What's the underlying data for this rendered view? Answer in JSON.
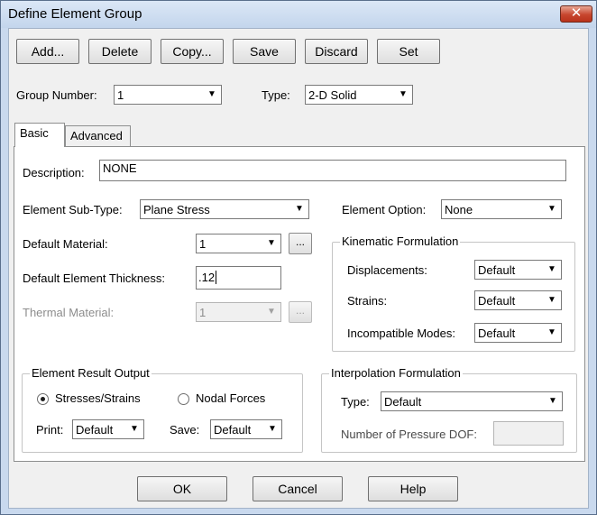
{
  "window": {
    "title": "Define Element Group",
    "close_glyph": "✕"
  },
  "toolbar": {
    "add": "Add...",
    "delete": "Delete",
    "copy": "Copy...",
    "save": "Save",
    "discard": "Discard",
    "set": "Set"
  },
  "header": {
    "group_number_label": "Group Number:",
    "group_number_value": "1",
    "type_label": "Type:",
    "type_value": "2-D Solid"
  },
  "tabs": {
    "basic": "Basic",
    "advanced": "Advanced"
  },
  "basic": {
    "description_label": "Description:",
    "description_value": "NONE",
    "subtype_label": "Element Sub-Type:",
    "subtype_value": "Plane Stress",
    "option_label": "Element Option:",
    "option_value": "None",
    "material_label": "Default Material:",
    "material_value": "1",
    "thickness_label": "Default Element Thickness:",
    "thickness_value": ".12",
    "thermal_label": "Thermal Material:",
    "thermal_value": "1",
    "browse_label": "...",
    "kinematic": {
      "title": "Kinematic Formulation",
      "displacements_label": "Displacements:",
      "displacements_value": "Default",
      "strains_label": "Strains:",
      "strains_value": "Default",
      "incompatible_label": "Incompatible Modes:",
      "incompatible_value": "Default"
    },
    "result_output": {
      "title": "Element Result Output",
      "stresses_strains": "Stresses/Strains",
      "nodal_forces": "Nodal Forces",
      "selected": "stresses_strains",
      "print_label": "Print:",
      "print_value": "Default",
      "save_label": "Save:",
      "save_value": "Default"
    },
    "interpolation": {
      "title": "Interpolation Formulation",
      "type_label": "Type:",
      "type_value": "Default",
      "pressure_dof_label": "Number of Pressure DOF:",
      "pressure_dof_value": ""
    }
  },
  "footer": {
    "ok": "OK",
    "cancel": "Cancel",
    "help": "Help"
  },
  "icons": {
    "dropdown": "chevron-down-icon",
    "close": "close-icon"
  }
}
